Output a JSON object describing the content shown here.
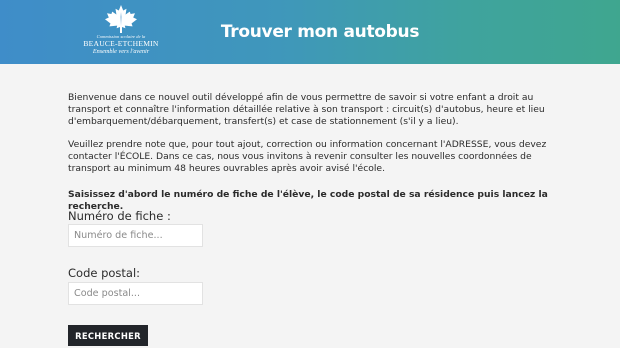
{
  "header": {
    "logo": {
      "line1": "Commission scolaire de la",
      "line2": "BEAUCE-ETCHEMIN",
      "tagline": "Ensemble vers l'avenir",
      "icon": "maple-leaf-icon"
    },
    "title": "Trouver mon autobus",
    "gradient_colors": [
      "#3f8dc9",
      "#3fa68f"
    ]
  },
  "main": {
    "paragraph1": "Bienvenue dans ce nouvel outil développé afin de vous permettre de savoir si votre enfant a droit au transport et connaître l'information détaillée relative à son transport : circuit(s) d'autobus, heure et lieu d'embarquement/débarquement, transfert(s) et case de stationnement (s'il y a lieu).",
    "paragraph2": "Veuillez prendre note que, pour tout ajout, correction ou information concernant l'ADRESSE, vous devez contacter l'ÉCOLE. Dans ce cas, nous vous invitons à revenir consulter les nouvelles coordonnées de transport au minimum 48 heures ouvrables après avoir avisé l'école.",
    "instruction": "Saisissez d'abord le numéro de fiche de l'élève, le code postal de sa résidence puis lancez la recherche."
  },
  "form": {
    "fiche_label": "Numéro de fiche :",
    "fiche_placeholder": "Numéro de fiche...",
    "fiche_value": "",
    "postal_label": "Code postal:",
    "postal_placeholder": "Code postal...",
    "postal_value": "",
    "submit_label": "RECHERCHER",
    "button_color": "#22252a"
  }
}
